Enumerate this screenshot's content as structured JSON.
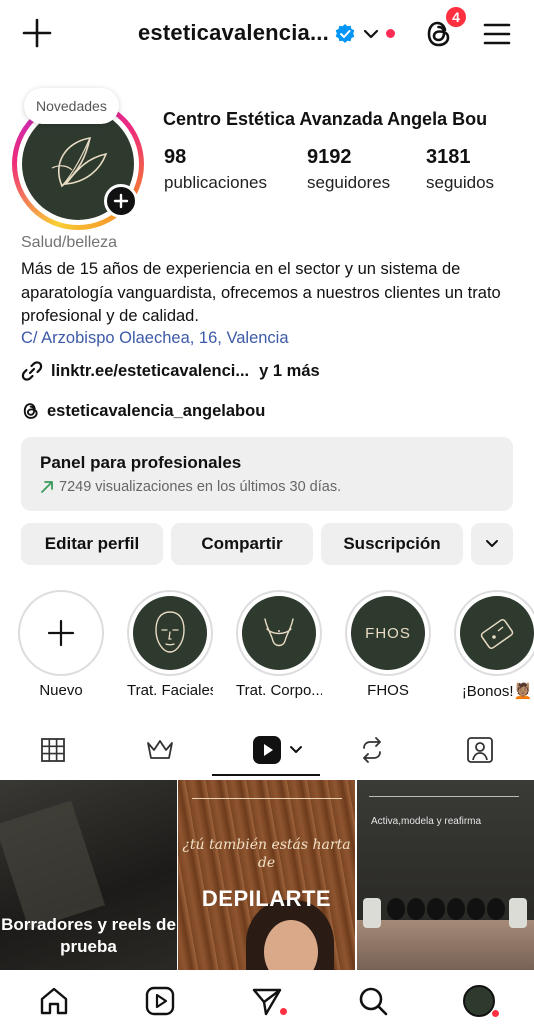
{
  "header": {
    "username": "esteticavalencia...",
    "notification_count": "4"
  },
  "profile": {
    "note": "Novedades",
    "full_name": "Centro Estética Avanzada Angela Bou",
    "stats": [
      {
        "value": "98",
        "label": "publicaciones"
      },
      {
        "value": "9192",
        "label": "seguidores"
      },
      {
        "value": "3181",
        "label": "seguidos"
      }
    ],
    "category": "Salud/belleza",
    "bio": "Más de 15 años de experiencia en el sector y un sistema de aparatología vanguardista, ofrecemos a nuestros clientes un trato profesional y de calidad.",
    "address": "C/ Arzobispo Olaechea, 16, Valencia",
    "link": "linktr.ee/esteticavalenci...",
    "link_more": "y 1 más",
    "threads_handle": "esteticavalencia_angelabou"
  },
  "panel": {
    "title": "Panel para profesionales",
    "subtitle": "7249 visualizaciones en los últimos 30 días."
  },
  "actions": {
    "edit": "Editar perfil",
    "share": "Compartir",
    "subscription": "Suscripción"
  },
  "highlights": [
    {
      "label": "Nuevo"
    },
    {
      "label": "Trat. Faciales"
    },
    {
      "label": "Trat. Corpo..."
    },
    {
      "label": "FHOS",
      "cover_text": "FHOS"
    },
    {
      "label": "¡Bonos!💆🏽"
    }
  ],
  "grid": {
    "tile1_caption": "Borradores y reels de prueba",
    "tile2_question": "¿tú también estás harta de",
    "tile2_big": "DEPILARTE",
    "tile3_header": "Activa,modela y reafirma"
  },
  "colors": {
    "link_blue": "#3d5aa8",
    "badge_red": "#ff3040",
    "verified_blue": "#0095f6",
    "highlight_bg": "#2f3a2f"
  }
}
